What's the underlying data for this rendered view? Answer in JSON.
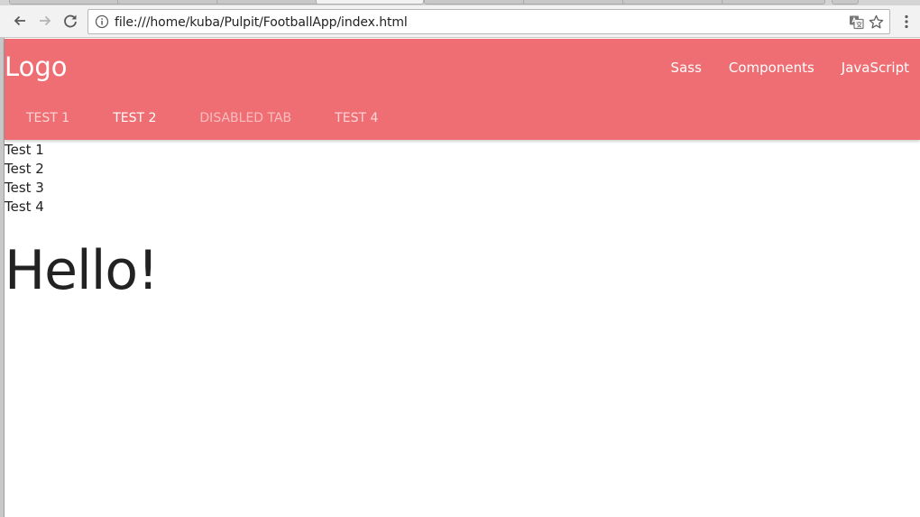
{
  "browser": {
    "url": "file:///home/kuba/Pulpit/FootballApp/index.html",
    "icons": {
      "back": "arrow-left-icon",
      "forward": "arrow-right-icon",
      "reload": "reload-icon",
      "info": "info-icon",
      "translate": "translate-icon",
      "bookmark": "star-icon",
      "menu": "kebab-menu-icon"
    }
  },
  "navbar": {
    "logo": "Logo",
    "links": [
      "Sass",
      "Components",
      "JavaScript"
    ],
    "color": "#ef6e73"
  },
  "tabs": [
    {
      "label": "Test 1",
      "state": "normal"
    },
    {
      "label": "Test 2",
      "state": "active"
    },
    {
      "label": "Disabled Tab",
      "state": "disabled"
    },
    {
      "label": "Test 4",
      "state": "normal"
    }
  ],
  "content": {
    "items": [
      "Test 1",
      "Test 2",
      "Test 3",
      "Test 4"
    ],
    "heading": "Hello!"
  }
}
